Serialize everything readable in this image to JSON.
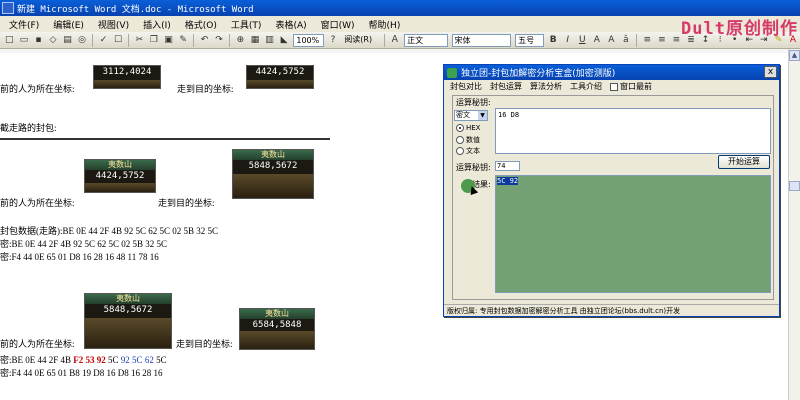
{
  "window": {
    "title": "新建 Microsoft Word 文档.doc - Microsoft Word"
  },
  "watermark": "Dult原创制作",
  "menu": [
    "文件(F)",
    "编辑(E)",
    "视图(V)",
    "插入(I)",
    "格式(O)",
    "工具(T)",
    "表格(A)",
    "窗口(W)",
    "帮助(H)"
  ],
  "toolbar": {
    "zoom": "100%",
    "read_label": "阅读(R)",
    "style": "正文",
    "font": "宋体",
    "size": "五号",
    "bold": "B",
    "italic": "I",
    "underline": "U"
  },
  "document": {
    "line1_label": "前的人为所在坐标:",
    "line1_coord": "3112,4024",
    "line1_target_label": "走到目的坐标:",
    "line1_target": "4424,5752",
    "intercept_label": "截走路的封包:",
    "block2_label": "前的人为所在坐标:",
    "block2_location": "夷数山",
    "block2_coord": "4424,5752",
    "block2_target_label": "走到目的坐标:",
    "block2_target_location": "夷数山",
    "block2_target": "5848,5672",
    "pkt_label": "封包数据(走路):",
    "pkt_a": "BE 0E 44 2F 4B",
    "pkt_a_u": "4B",
    "pkt_b": "92 5C 62 5C 02 5B 32 5C",
    "enc_label": "密:",
    "enc_a": "BE 0E 44 2F 4B",
    "enc_a_u": "4B",
    "enc_b": "92 5C 62 5C 02 5B 32 5C",
    "dec_label": "密:",
    "dec": "F4 44 0E 65 01",
    "dec_u": "01",
    "dec_b": "D8 16 28 16 48 11 78 16",
    "block3_label": "前的人为所在坐标:",
    "block3_location": "夷数山",
    "block3_coord": "5848,5672",
    "block3_target_label": "走到目的坐标:",
    "block3_target_location": "夷数山",
    "block3_target": "6584,5848",
    "enc2_label": "密:",
    "enc2_a": "BE 0E 44 2F 4B",
    "enc2_a_u": "4B",
    "enc2_red": "F2 53 92",
    "enc2_rest1": "5C",
    "enc2_blue1": "92 5C",
    "enc2_blue2": "62",
    "enc2_rest2": "5C",
    "dec2_label": "密:",
    "dec2": "F4 44 0E 65 01",
    "dec2_u": "01",
    "dec2_b": "B8 19 D8 16 D8 16 28 16"
  },
  "tool": {
    "title": "独立团-封包加解密分析宝盒(加密测版)",
    "close": "x",
    "tabs": [
      "封包对比",
      "封包运算",
      "算法分析",
      "工具介绍"
    ],
    "topmost_label": "窗口最前",
    "key_label": "运算秘钥:",
    "key_mode": "密文",
    "key_value": "16 D8",
    "radios": [
      "HEX",
      "数值",
      "文本"
    ],
    "value_label": "运算秘钥:",
    "value": "74",
    "run_button": "开始运算",
    "result_label": "结果:",
    "result": "5C 92",
    "status": "版权归属: 专用封包数据加密解密分析工具 由独立团论坛(bbs.dult.cn)开发"
  },
  "colors": {
    "accent": "#0a5fd8",
    "result_bg": "#73a173",
    "highlight_red": "#c00000",
    "highlight_blue": "#1a3fb0"
  }
}
